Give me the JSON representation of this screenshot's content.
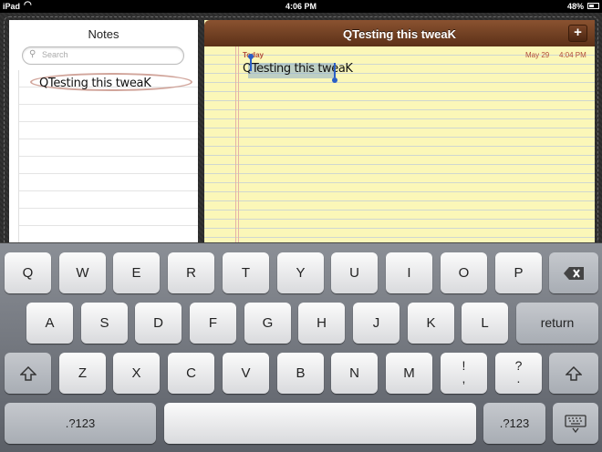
{
  "status": {
    "device": "iPad",
    "time": "4:06 PM",
    "battery": "48%"
  },
  "sidebar": {
    "title": "Notes",
    "search_placeholder": "Search",
    "notes": [
      "QTesting this tweaK"
    ]
  },
  "note": {
    "title": "QTesting this tweaK",
    "add_label": "+",
    "day": "Today",
    "date": "May 29",
    "time": "4:04 PM",
    "body": "QTesting this tweaK"
  },
  "keyboard": {
    "row1": [
      "Q",
      "W",
      "E",
      "R",
      "T",
      "Y",
      "U",
      "I",
      "O",
      "P"
    ],
    "row2": [
      "A",
      "S",
      "D",
      "F",
      "G",
      "H",
      "J",
      "K",
      "L"
    ],
    "row3": [
      "Z",
      "X",
      "C",
      "V",
      "B",
      "N",
      "M"
    ],
    "return": "return",
    "numbers": ".?123",
    "punct1_top": "!",
    "punct1_bottom": ",",
    "punct2_top": "?",
    "punct2_bottom": "."
  }
}
